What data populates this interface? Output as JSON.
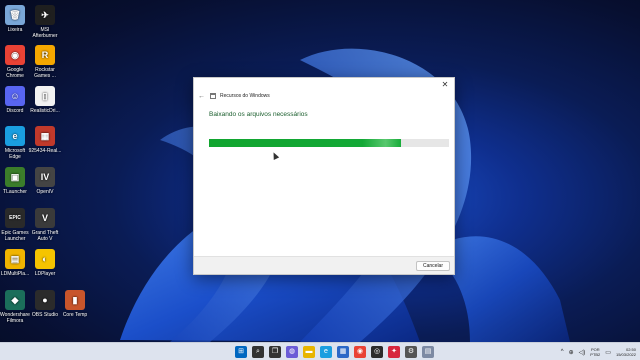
{
  "desktop": {
    "icons": [
      {
        "label": "Lixeira",
        "glyph": "🗑",
        "color": "#7aa7d8"
      },
      {
        "label": "MSI\nAfterburner",
        "glyph": "✈",
        "color": "#1f1f1f"
      },
      {
        "label": "Google\nChrome",
        "glyph": "◉",
        "color": "#e94235"
      },
      {
        "label": "Rockstar\nGames ...",
        "glyph": "R",
        "color": "#f5a700"
      },
      {
        "label": "Discord",
        "glyph": "☺",
        "color": "#5865f2"
      },
      {
        "label": "RealisticDri...",
        "glyph": "▯",
        "color": "#f2f2f2"
      },
      {
        "label": "Microsoft\nEdge",
        "glyph": "e",
        "color": "#1a9ee0"
      },
      {
        "label": "925434-Real...",
        "glyph": "▦",
        "color": "#c0392b"
      },
      {
        "label": "TLauncher",
        "glyph": "▣",
        "color": "#3b7d2a"
      },
      {
        "label": "OpenIV",
        "glyph": "IV",
        "color": "#444444"
      },
      {
        "label": "Epic Games\nLauncher",
        "glyph": "EPIC",
        "color": "#2a2a2a"
      },
      {
        "label": "Grand Theft\nAuto V",
        "glyph": "V",
        "color": "#3a3a3a"
      },
      {
        "label": "LDMultiPla...",
        "glyph": "▤",
        "color": "#f0b400"
      },
      {
        "label": "LDPlayer",
        "glyph": "◐",
        "color": "#f5c400"
      },
      {
        "label": "Wondershare\nFilmora",
        "glyph": "◆",
        "color": "#1b6e5a"
      },
      {
        "label": "OBS Studio",
        "glyph": "●",
        "color": "#2b2b2b"
      },
      {
        "label": "Core Temp",
        "glyph": "▮",
        "color": "#c8552b"
      }
    ]
  },
  "dialog": {
    "title": "Recursos do Windows",
    "close_glyph": "✕",
    "back_glyph": "←",
    "heading": "Baixando os arquivos necessários",
    "progress": 0.8,
    "cancel_label": "Cancelar"
  },
  "taskbar": {
    "icons": [
      {
        "name": "start",
        "glyph": "⊞",
        "color": "#0067c0"
      },
      {
        "name": "search",
        "glyph": "⌕",
        "color": "#333333"
      },
      {
        "name": "task-view",
        "glyph": "❐",
        "color": "#333333"
      },
      {
        "name": "chat",
        "glyph": "◍",
        "color": "#6b5cd6"
      },
      {
        "name": "file-explorer",
        "glyph": "▬",
        "color": "#e8b500"
      },
      {
        "name": "edge",
        "glyph": "e",
        "color": "#1a9ee0"
      },
      {
        "name": "store",
        "glyph": "▦",
        "color": "#2b68c7"
      },
      {
        "name": "chrome",
        "glyph": "◉",
        "color": "#e94235"
      },
      {
        "name": "xbox",
        "glyph": "◎",
        "color": "#2b2b2b"
      },
      {
        "name": "app-red",
        "glyph": "✦",
        "color": "#d7263d"
      },
      {
        "name": "settings",
        "glyph": "⚙",
        "color": "#555555"
      },
      {
        "name": "windows-features",
        "glyph": "▤",
        "color": "#7d8aa3"
      }
    ],
    "tray": {
      "chevron": "^",
      "network": "⊕",
      "volume": "◁)",
      "lang_line1": "POR",
      "lang_line2": "PTB2",
      "time": "02:50",
      "date": "15/03/2022",
      "notification": "▭"
    }
  }
}
